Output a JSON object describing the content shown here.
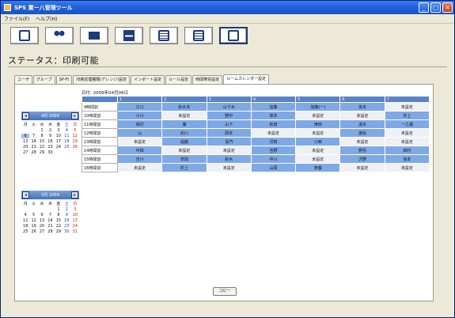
{
  "window": {
    "title": "SPS 業ー八管理ツール"
  },
  "menu": [
    "ファイル(F)",
    "ヘルプ(H)"
  ],
  "toolbar": [
    {
      "icon": "door-icon"
    },
    {
      "icon": "users-icon"
    },
    {
      "icon": "computer-icon"
    },
    {
      "icon": "printer-icon"
    },
    {
      "icon": "list-icon"
    },
    {
      "icon": "document-icon"
    },
    {
      "icon": "export-icon"
    }
  ],
  "status": "ステータス：印刷可能",
  "tabs": [
    "ユーザ",
    "グループ",
    "SP-Ft",
    "印刷処理種類(アレンジ)設定",
    "インポート設定",
    "ルール設定",
    "時間帯別設定",
    "ルームカレンダー設定"
  ],
  "active_tab": 7,
  "calendars": [
    {
      "title": "4月 2009",
      "dow": [
        "月",
        "火",
        "水",
        "木",
        "金",
        "土",
        "日"
      ],
      "weeks": [
        [
          "",
          "",
          "1",
          "2",
          "3",
          "4",
          "5"
        ],
        [
          "6",
          "7",
          "8",
          "9",
          "10",
          "11",
          "12"
        ],
        [
          "13",
          "14",
          "15",
          "16",
          "17",
          "18",
          "19"
        ],
        [
          "20",
          "21",
          "22",
          "23",
          "24",
          "25",
          "26"
        ],
        [
          "27",
          "28",
          "29",
          "30",
          "",
          "",
          ""
        ]
      ],
      "today": "6"
    },
    {
      "title": "5月 2009",
      "dow": [
        "月",
        "火",
        "水",
        "木",
        "金",
        "土",
        "日"
      ],
      "weeks": [
        [
          "",
          "",
          "",
          "",
          "1",
          "2",
          "3"
        ],
        [
          "4",
          "5",
          "6",
          "7",
          "8",
          "9",
          "10"
        ],
        [
          "11",
          "12",
          "13",
          "14",
          "15",
          "16",
          "17"
        ],
        [
          "18",
          "19",
          "20",
          "21",
          "22",
          "23",
          "24"
        ],
        [
          "25",
          "26",
          "27",
          "28",
          "29",
          "30",
          "31"
        ]
      ],
      "today": ""
    }
  ],
  "schedule": {
    "date_label": "日付: 2009年04月06日",
    "columns": [
      "1",
      "2",
      "3",
      "4",
      "5",
      "6",
      "7"
    ],
    "rows": [
      {
        "label": "9時間割",
        "cells": [
          "江川",
          "鈴木本",
          "山下木",
          "加藤",
          "加藤(一)",
          "坂本",
          "未設定"
        ]
      },
      {
        "label": "10時間割",
        "cells": [
          "小川",
          "未設定",
          "野中",
          "岸井",
          "未設定",
          "未設定",
          "井上"
        ]
      },
      {
        "label": "11時間割",
        "cells": [
          "相沢",
          "瀬",
          "山下",
          "新田",
          "津田",
          "湯本",
          "一之瀬"
        ]
      },
      {
        "label": "12時間割",
        "cells": [
          "山",
          "石川",
          "岡本",
          "未設定",
          "未設定",
          "渡会",
          "未設定"
        ]
      },
      {
        "label": "13時間割",
        "cells": [
          "未設定",
          "堀越",
          "長門",
          "沢田",
          "小西",
          "未設定",
          "未設定"
        ]
      },
      {
        "label": "14時間割",
        "cells": [
          "中田",
          "未設定",
          "未設定",
          "吉野",
          "未設定",
          "野島",
          "田村"
        ]
      },
      {
        "label": "15時間割",
        "cells": [
          "吉川",
          "草間",
          "鈴木",
          "中川",
          "未設定",
          "沢野",
          "坂本"
        ]
      },
      {
        "label": "16時間割",
        "cells": [
          "未設定",
          "村上",
          "未設定",
          "山岡",
          "斉藤",
          "未設定",
          "未設定"
        ]
      }
    ]
  },
  "copy_button": "コピー"
}
